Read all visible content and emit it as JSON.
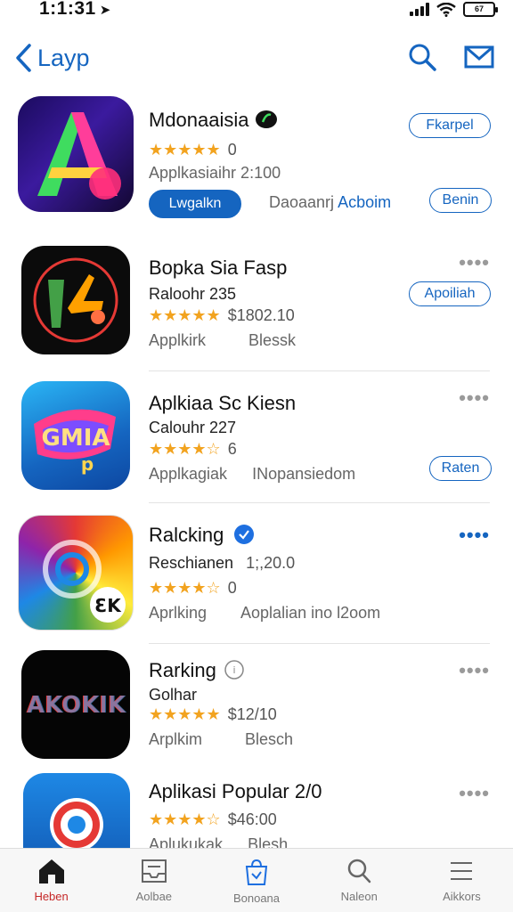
{
  "status": {
    "time": "1:1:31",
    "battery": "67"
  },
  "nav": {
    "back_label": "Layp"
  },
  "apps": [
    {
      "name": "Mdonaaisia",
      "rating": "★★★★★",
      "rating_value": "0",
      "line2": "Applkasiaihr 2:100",
      "install_label": "Lwgalkn",
      "action_label": "Fkarpel",
      "extra_gray": "Daoaanrj",
      "extra_blue": "Acboim",
      "secondary_label": "Benin"
    },
    {
      "name": "Bopka Sia Fasp",
      "line1": "Raloohr 235",
      "rating": "★★★★★",
      "rating_value": "$1802.10",
      "line3a": "Applkirk",
      "line3b": "Blessk",
      "action_label": "Apoiliah"
    },
    {
      "name": "Aplkiaa Sc Kiesn",
      "line1": "Calouhr 227",
      "rating": "★★★★☆",
      "rating_value": "6",
      "line3a": "Applkagiak",
      "line3b": "INopansiedom",
      "action_label": "Raten"
    },
    {
      "name": "Ralcking",
      "line1": "Reschianen",
      "line1b": "1;,20.0",
      "rating": "★★★★☆",
      "rating_value": "0",
      "line3a": "Aprlking",
      "line3b": "Aoplalian ino l2oom"
    },
    {
      "name": "Rarking",
      "line1": "Golhar",
      "rating": "★★★★★",
      "rating_value": "$12/10",
      "line3a": "Arplkim",
      "line3b": "Blesch"
    },
    {
      "name": "Aplikasi Popular 2/0",
      "rating": "★★★★☆",
      "rating_value": "$46:00",
      "line3a": "Aplukukak",
      "line3b": "Blesh"
    }
  ],
  "tabs": [
    {
      "label": "Heben",
      "icon": "house-icon"
    },
    {
      "label": "Aolbae",
      "icon": "inbox-icon"
    },
    {
      "label": "Bonoana",
      "icon": "app-bag-icon"
    },
    {
      "label": "Naleon",
      "icon": "search-icon"
    },
    {
      "label": "Aikkors",
      "icon": "menu-icon"
    }
  ],
  "colors": {
    "accent": "#1565c0",
    "stars": "#f2a31f",
    "active_tab": "#c62828"
  }
}
